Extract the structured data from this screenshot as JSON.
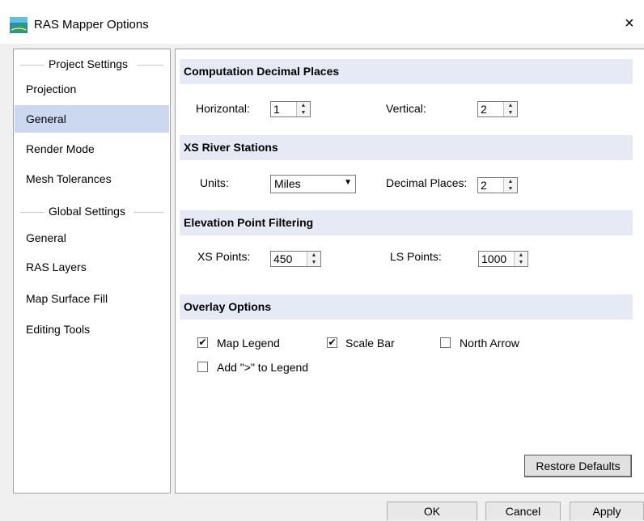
{
  "window": {
    "title": "RAS Mapper Options",
    "close_glyph": "×"
  },
  "sidebar": {
    "group_project": "Project Settings",
    "project_items": [
      "Projection",
      "General",
      "Render Mode",
      "Mesh Tolerances"
    ],
    "group_global": "Global Settings",
    "global_items": [
      "General",
      "RAS Layers",
      "Map Surface Fill",
      "Editing Tools"
    ],
    "selected": "General"
  },
  "computation": {
    "header": "Computation Decimal Places",
    "horizontal_label": "Horizontal:",
    "horizontal_value": "1",
    "vertical_label": "Vertical:",
    "vertical_value": "2"
  },
  "xs_stations": {
    "header": "XS River Stations",
    "units_label": "Units:",
    "units_value": "Miles",
    "decimal_label": "Decimal Places:",
    "decimal_value": "2"
  },
  "elevation": {
    "header": "Elevation Point Filtering",
    "xs_label": "XS Points:",
    "xs_value": "450",
    "ls_label": "LS Points:",
    "ls_value": "1000"
  },
  "overlay": {
    "header": "Overlay Options",
    "map_legend": {
      "label": "Map Legend",
      "checked": true
    },
    "scale_bar": {
      "label": "Scale Bar",
      "checked": true
    },
    "north_arrow": {
      "label": "North Arrow",
      "checked": false
    },
    "add_gt_legend": {
      "label": "Add \">\" to Legend",
      "checked": false
    }
  },
  "buttons": {
    "restore": "Restore Defaults",
    "ok": "OK",
    "cancel": "Cancel",
    "apply": "Apply"
  },
  "icons": {
    "app": "ras-mapper-app-icon",
    "close": "close-icon",
    "spinner": "spinner-arrows-icon",
    "dropdown": "chevron-down-icon",
    "check": "checkmark-icon"
  },
  "colors": {
    "selected_nav": "#ccd8f0",
    "section_header": "#e6eaf4"
  }
}
